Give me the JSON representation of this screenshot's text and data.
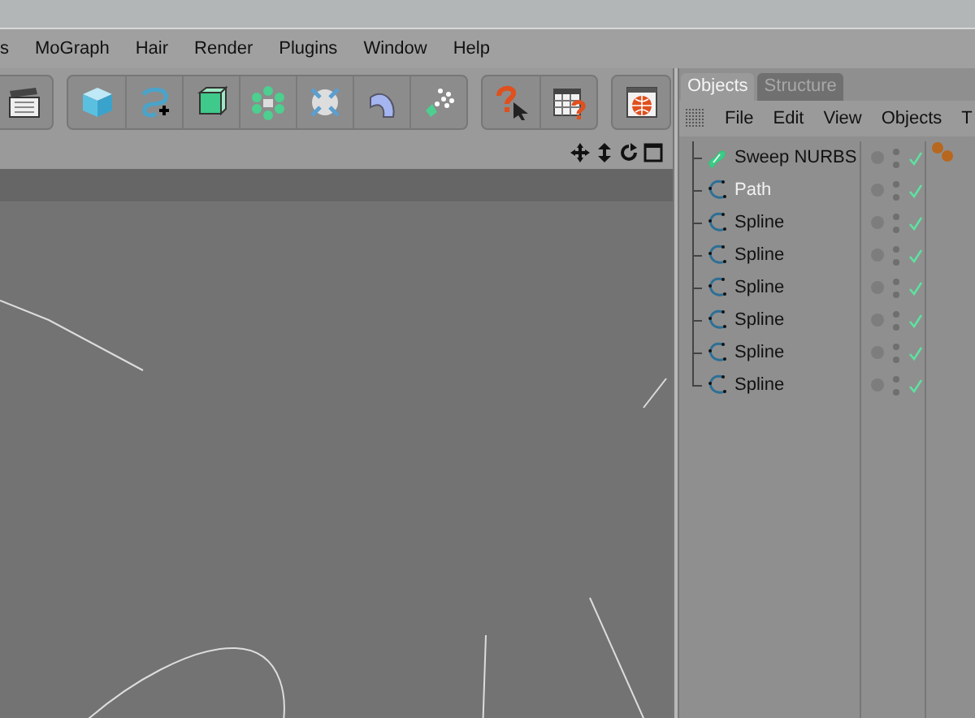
{
  "menu_bar": [
    "s",
    "MoGraph",
    "Hair",
    "Render",
    "Plugins",
    "Window",
    "Help"
  ],
  "panel": {
    "tabs": [
      {
        "label": "Objects",
        "selected": true
      },
      {
        "label": "Structure",
        "selected": false
      }
    ],
    "menu": [
      "File",
      "Edit",
      "View",
      "Objects",
      "T"
    ],
    "objects": [
      {
        "name": "Sweep NURBS",
        "kind": "nurbs",
        "selected": false,
        "material": true
      },
      {
        "name": "Path",
        "kind": "spline",
        "selected": true,
        "material": false
      },
      {
        "name": "Spline",
        "kind": "spline",
        "selected": false,
        "material": false
      },
      {
        "name": "Spline",
        "kind": "spline",
        "selected": false,
        "material": false
      },
      {
        "name": "Spline",
        "kind": "spline",
        "selected": false,
        "material": false
      },
      {
        "name": "Spline",
        "kind": "spline",
        "selected": false,
        "material": false
      },
      {
        "name": "Spline",
        "kind": "spline",
        "selected": false,
        "material": false
      },
      {
        "name": "Spline",
        "kind": "spline",
        "selected": false,
        "material": false
      }
    ]
  }
}
